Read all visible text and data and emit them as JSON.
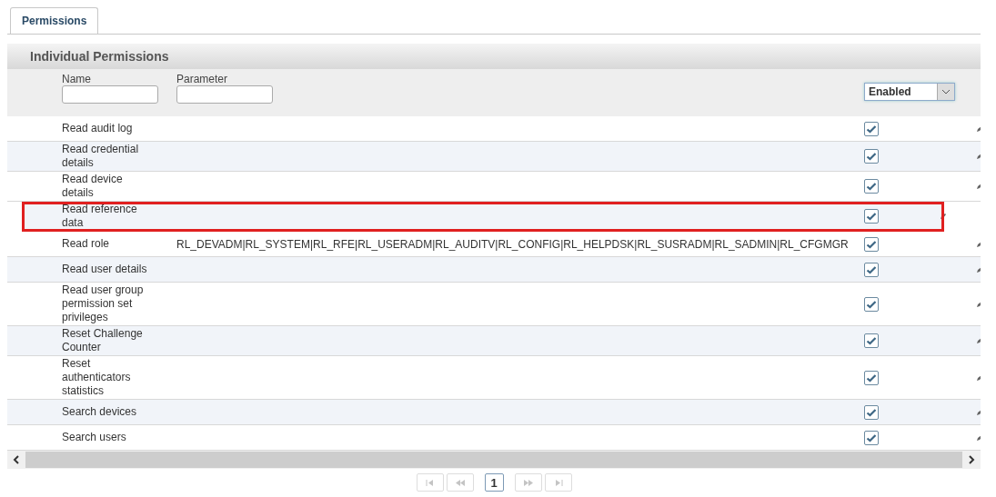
{
  "tabs": [
    {
      "label": "Permissions",
      "selected": true
    }
  ],
  "panel": {
    "title": "Individual Permissions"
  },
  "filters": {
    "name": {
      "label": "Name"
    },
    "parameter": {
      "label": "Parameter"
    },
    "status": {
      "value": "Enabled"
    }
  },
  "rows": [
    {
      "name": "Read audit log",
      "checked": true,
      "highlighted": false
    },
    {
      "name": "Read credential details",
      "checked": true,
      "highlighted": false
    },
    {
      "name": "Read device details",
      "checked": true,
      "highlighted": false
    },
    {
      "name": "Read reference data",
      "checked": true,
      "highlighted": true
    },
    {
      "name": "Read role",
      "parameter": "RL_DEVADM|RL_SYSTEM|RL_RFE|RL_USERADM|RL_AUDITV|RL_CONFIG|RL_HELPDSK|RL_SUSRADM|RL_SADMIN|RL_CFGMGR",
      "checked": true,
      "highlighted": false
    },
    {
      "name": "Read user details",
      "checked": true,
      "highlighted": false
    },
    {
      "name": "Read user group permission set privileges",
      "checked": true,
      "highlighted": false
    },
    {
      "name": "Reset Challenge Counter",
      "checked": true,
      "highlighted": false
    },
    {
      "name": "Reset authenticators statistics",
      "checked": true,
      "highlighted": false
    },
    {
      "name": "Search devices",
      "checked": true,
      "highlighted": false
    },
    {
      "name": "Search users",
      "checked": true,
      "highlighted": false
    }
  ],
  "pagination": [
    {
      "kind": "first",
      "disabled": true
    },
    {
      "kind": "prev",
      "disabled": true
    },
    {
      "kind": "page",
      "label": "1",
      "selected": true
    },
    {
      "kind": "next",
      "disabled": true
    },
    {
      "kind": "last",
      "disabled": true
    }
  ]
}
